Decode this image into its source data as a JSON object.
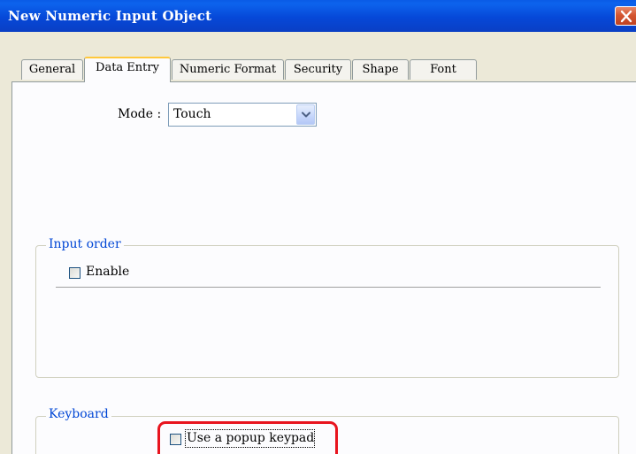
{
  "window": {
    "title": "New  Numeric Input Object",
    "close_icon": "close-icon"
  },
  "tabs": [
    {
      "label": "General",
      "active": false
    },
    {
      "label": "Data Entry",
      "active": true
    },
    {
      "label": "Numeric Format",
      "active": false
    },
    {
      "label": "Security",
      "active": false
    },
    {
      "label": "Shape",
      "active": false
    },
    {
      "label": "Font",
      "active": false
    }
  ],
  "mode": {
    "label": "Mode :",
    "value": "Touch",
    "dropdown_icon": "chevron-down-icon"
  },
  "input_order": {
    "legend": "Input order",
    "enable_label": "Enable",
    "enable_checked": false
  },
  "keyboard": {
    "legend": "Keyboard",
    "popup_label": "Use a popup keypad",
    "popup_checked": false
  },
  "colors": {
    "title_bar": "#0a5be6",
    "group_legend": "#0046d5",
    "highlight": "#e8141e",
    "active_tab_accent": "#ffc83c"
  }
}
